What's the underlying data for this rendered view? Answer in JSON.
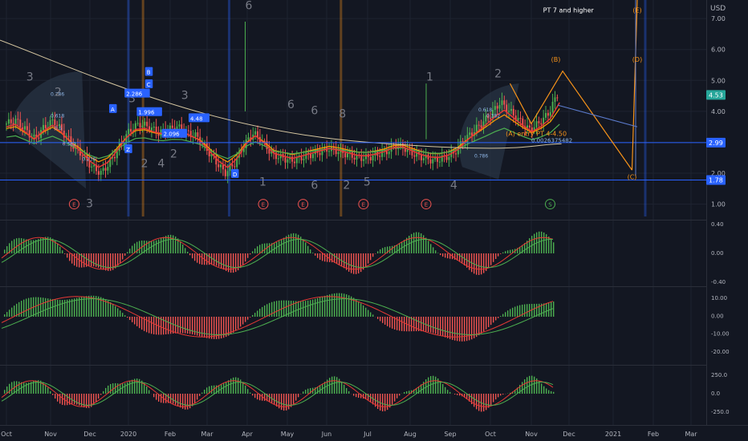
{
  "chart_data": {
    "type": "candlestick",
    "currency": "USD",
    "x_ticks": [
      "Oct",
      "Nov",
      "Dec",
      "2020",
      "Feb",
      "Mar",
      "Apr",
      "May",
      "Jun",
      "Jul",
      "Aug",
      "Sep",
      "Oct",
      "Nov",
      "Dec",
      "2021",
      "Feb",
      "Mar"
    ],
    "price_axis": {
      "ticks": [
        7.0,
        6.0,
        5.0,
        4.0,
        3.0,
        2.0,
        1.0
      ],
      "ylim": [
        0.6,
        7.6
      ],
      "labels": [
        "7.00",
        "6.00",
        "5.00",
        "4.00",
        "3.00",
        "2.00",
        "1.00"
      ]
    },
    "price_badges": [
      {
        "value": 4.53,
        "text": "4.53",
        "color": "#26a69a"
      },
      {
        "value": 2.99,
        "text": "2.99",
        "color": "#2962ff"
      },
      {
        "value": 1.78,
        "text": "1.78",
        "color": "#2962ff"
      }
    ],
    "horizontal_levels": [
      2.99,
      1.78
    ],
    "close_series": [
      3.6,
      3.7,
      3.4,
      3.1,
      3.5,
      3.7,
      3.3,
      2.9,
      2.6,
      2.2,
      2.0,
      2.4,
      2.9,
      3.4,
      3.6,
      3.5,
      3.3,
      3.4,
      3.5,
      3.3,
      3.2,
      2.8,
      2.4,
      2.0,
      2.3,
      2.9,
      3.3,
      3.0,
      2.6,
      2.5,
      2.4,
      2.5,
      2.6,
      2.7,
      2.8,
      2.7,
      2.6,
      2.5,
      2.5,
      2.6,
      2.7,
      2.9,
      2.8,
      2.6,
      2.5,
      2.4,
      2.5,
      2.6,
      3.0,
      3.3,
      3.6,
      3.9,
      4.3,
      4.0,
      3.7,
      3.4,
      3.6,
      3.9,
      4.53
    ],
    "projection": {
      "points": [
        [
          4.8,
          4.9
        ],
        [
          5.0,
          3.6
        ],
        [
          5.32,
          5.3
        ],
        [
          5.95,
          2.1
        ],
        [
          6.0,
          7.6
        ]
      ],
      "labels": [
        {
          "text": "(A) entry PT 4-4.50",
          "at": [
            5.05,
            3.2
          ]
        },
        {
          "text": "(B)",
          "at": [
            5.25,
            5.6
          ]
        },
        {
          "text": "(C)",
          "at": [
            5.95,
            1.8
          ]
        },
        {
          "text": "(D)",
          "at": [
            6.0,
            5.6
          ]
        },
        {
          "text": "(E)",
          "at": [
            6.0,
            7.2
          ]
        },
        {
          "text": "PT 7 and higher",
          "at": [
            5.6,
            7.2
          ]
        }
      ]
    },
    "fib_labels": [
      "0.786",
      "0.618",
      "0.5",
      "0.382",
      "0.236",
      "0.786",
      "0.618",
      "0.382"
    ],
    "wave_labels": [
      "3",
      "2",
      "3",
      "2",
      "4",
      "3",
      "2",
      "6",
      "6",
      "8",
      "6",
      "1",
      "6",
      "2",
      "5",
      "4",
      "1",
      "2",
      "3"
    ],
    "box_labels": [
      "2.286",
      "1.996",
      "2.096",
      "4.48",
      "A",
      "B",
      "C",
      "D",
      "Z"
    ],
    "text_annotations": [
      "0.0026375482"
    ],
    "e_markers": [
      "E",
      "E",
      "E",
      "E",
      "E",
      "S"
    ],
    "osc1": {
      "ticks": [
        "0.40",
        "0.00",
        "-0.40"
      ]
    },
    "osc2": {
      "ticks": [
        "10.00",
        "0.00",
        "-10.00",
        "-20.00"
      ]
    },
    "osc3": {
      "ticks": [
        "250.0",
        "0.0",
        "-250.0"
      ]
    },
    "colors": {
      "bg": "#131722",
      "up": "#4caf50",
      "down": "#ef5350",
      "fib_fill": "#2a3646",
      "accent_orange": "#f7931a",
      "blue": "#2962ff",
      "grid": "#1e2330"
    }
  }
}
